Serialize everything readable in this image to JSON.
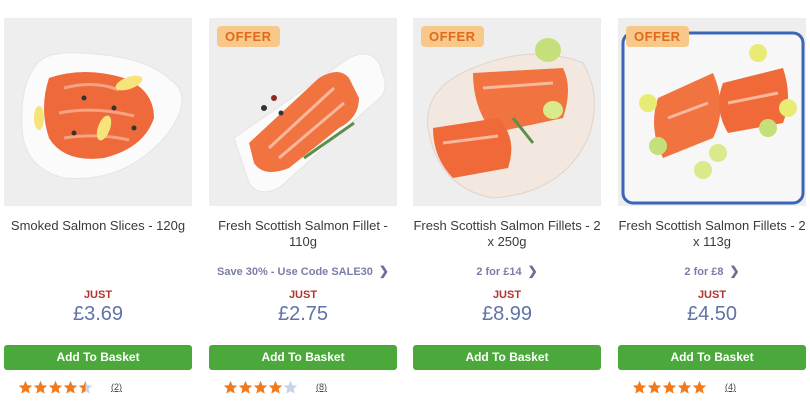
{
  "products": [
    {
      "offer": "",
      "title": "Smoked Salmon Slices - 120g",
      "promo": "",
      "just": "JUST",
      "price": "£3.69",
      "button": "Add To Basket",
      "rating": 4.5,
      "review_count": "(2)"
    },
    {
      "offer": "OFFER",
      "title": "Fresh Scottish Salmon Fillet - 110g",
      "promo": "Save 30% - Use Code SALE30",
      "just": "JUST",
      "price": "£2.75",
      "button": "Add To Basket",
      "rating": 4,
      "review_count": "(8)"
    },
    {
      "offer": "OFFER",
      "title": "Fresh Scottish Salmon Fillets - 2 x 250g",
      "promo": "2 for £14",
      "just": "JUST",
      "price": "£8.99",
      "button": "Add To Basket",
      "rating": null,
      "review_count": ""
    },
    {
      "offer": "OFFER",
      "title": "Fresh Scottish Salmon Fillets - 2 x 113g",
      "promo": "2 for £8",
      "just": "JUST",
      "price": "£4.50",
      "button": "Add To Basket",
      "rating": 5,
      "review_count": "(4)"
    }
  ],
  "icons": {
    "promo_arrow": "chevron-right-icon",
    "star": "star-icon"
  },
  "colors": {
    "button": "#4aa93a",
    "price": "#6073a8",
    "just": "#b3332e",
    "offer_bg": "#f7c889",
    "offer_text": "#e06a1a",
    "star_filled": "#f07a1c",
    "star_empty": "#c9d2e6"
  }
}
